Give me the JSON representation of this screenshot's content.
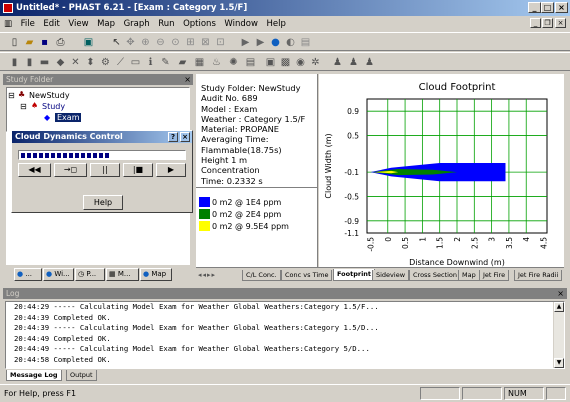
{
  "window": {
    "title": "Untitled* - PHAST 6.21 - [Exam : Category 1.5/F]"
  },
  "menu": [
    "File",
    "Edit",
    "View",
    "Map",
    "Graph",
    "Run",
    "Options",
    "Window",
    "Help"
  ],
  "study_folder": {
    "title": "Study Folder",
    "tree": [
      {
        "label": "NewStudy",
        "level": 0
      },
      {
        "label": "Study",
        "level": 1
      },
      {
        "label": "Exam",
        "level": 2,
        "selected": true
      }
    ],
    "bottom_tabs": [
      "...",
      "Wi...",
      "P...",
      "M...",
      "Map"
    ]
  },
  "cloud_dialog": {
    "title": "Cloud Dynamics Control",
    "progress_fraction": 0.55,
    "help_label": "Help"
  },
  "info": {
    "lines": [
      "Study Folder: NewStudy",
      "Audit No. 689",
      "Model : Exam",
      "Weather : Category 1.5/F",
      "Material: PROPANE",
      "Averaging Time:",
      "Flammable(18.75s)",
      "Height 1 m",
      "Concentration",
      "Time: 0.2332 s"
    ],
    "legend": [
      {
        "label": "0 m2 @ 1E4 ppm",
        "color": "#0000ff"
      },
      {
        "label": "0 m2 @ 2E4 ppm",
        "color": "#008000"
      },
      {
        "label": "0 m2 @ 9.5E4 ppm",
        "color": "#ffff00"
      }
    ]
  },
  "chart_data": {
    "type": "area",
    "title": "Cloud Footprint",
    "xlabel": "Distance Downwind (m)",
    "ylabel": "Cloud Width (m)",
    "xlim": [
      -0.6,
      4.6
    ],
    "ylim": [
      -1.1,
      1.1
    ],
    "xticks": [
      0,
      0.5,
      1,
      1.5,
      2,
      2.5,
      3,
      3.5,
      4
    ],
    "yticks": [
      0.9,
      0.5,
      -0.1,
      -0.5,
      -0.9
    ],
    "xtick_labels": [
      "0",
      "0.5",
      "1",
      "1.5",
      "2",
      "2.5",
      "3",
      "3.5",
      "4"
    ],
    "ytick_labels": [
      "0.9",
      "0.5",
      "-0.1",
      "-0.5",
      "-0.9"
    ],
    "extra_tick_labels": {
      "y_bottom": "-1.1",
      "x_left": "-0.5",
      "x_right": "4.5"
    },
    "grid": true,
    "series": [
      {
        "color": "#0000ff",
        "polygon": [
          [
            -0.5,
            -0.1
          ],
          [
            0.1,
            -0.03
          ],
          [
            1.5,
            0.05
          ],
          [
            3.4,
            0.05
          ],
          [
            3.4,
            -0.25
          ],
          [
            1.5,
            -0.25
          ],
          [
            0.1,
            -0.17
          ]
        ]
      },
      {
        "color": "#008000",
        "polygon": [
          [
            -0.45,
            -0.1
          ],
          [
            0.3,
            -0.05
          ],
          [
            1.3,
            -0.06
          ],
          [
            2.0,
            -0.1
          ],
          [
            1.3,
            -0.14
          ],
          [
            0.3,
            -0.15
          ]
        ]
      },
      {
        "color": "#ffff00",
        "polygon": [
          [
            -0.4,
            -0.1
          ],
          [
            0.1,
            -0.08
          ],
          [
            0.3,
            -0.1
          ],
          [
            0.1,
            -0.12
          ]
        ]
      }
    ]
  },
  "result_tabs": [
    "C/L Conc.",
    "Conc vs Time",
    "Footprint",
    "Sideview",
    "Cross Section",
    "Map",
    "Jet Fire",
    "Jet Fire Radii"
  ],
  "active_result_tab": "Footprint",
  "log": {
    "title": "Log",
    "lines": [
      "20:44:29 ----- Calculating Model Exam for Weather Global Weathers:Category 1.5/F...",
      "20:44:39 Completed OK.",
      "20:44:39 ----- Calculating Model Exam for Weather Global Weathers:Category 1.5/D...",
      "20:44:49 Completed OK.",
      "20:44:49 ----- Calculating Model Exam for Weather Global Weathers:Category 5/D...",
      "20:44:58 Completed OK."
    ],
    "tabs": [
      "Message Log",
      "Output"
    ]
  },
  "status": {
    "text": "For Help, press F1",
    "num": "NUM"
  }
}
